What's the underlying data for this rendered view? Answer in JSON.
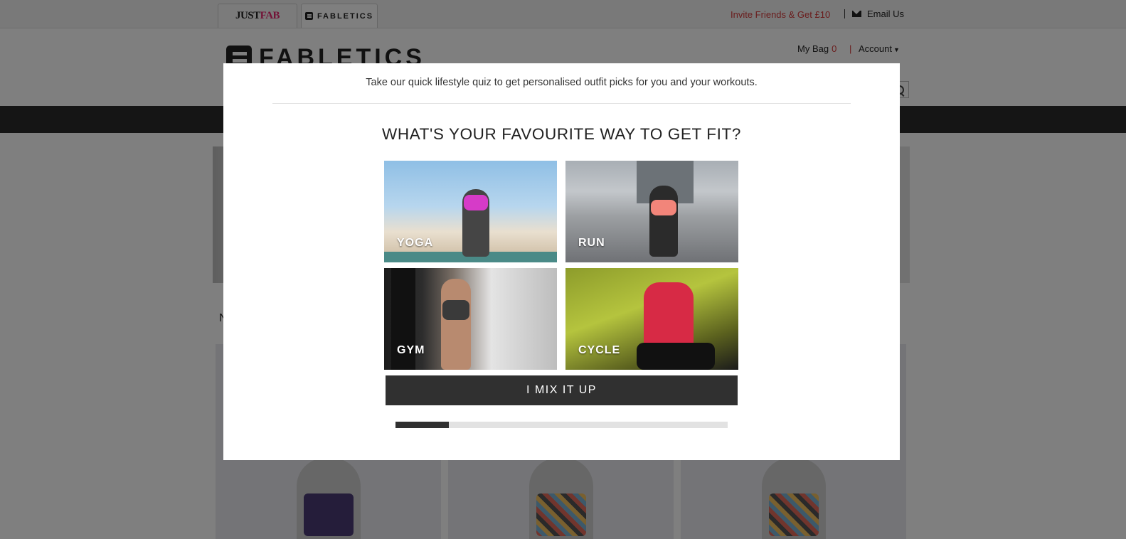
{
  "topbar": {
    "brand_tabs": [
      {
        "label_just": "JUST",
        "label_fab": "FAB"
      },
      {
        "label": "FABLETICS"
      }
    ],
    "invite_link": "Invite Friends & Get £10",
    "email_link": "Email Us"
  },
  "header": {
    "logo_text": "FABLETICS",
    "my_bag_label": "My Bag",
    "bag_count": "0",
    "separator": "|",
    "account_label": "Account"
  },
  "section": {
    "title_partial": "N",
    "more_arrow": "›"
  },
  "modal": {
    "intro": "Take our quick lifestyle quiz to get personalised outfit picks for you and your workouts.",
    "question": "WHAT'S YOUR FAVOURITE WAY TO GET FIT?",
    "options": [
      {
        "label": "YOGA"
      },
      {
        "label": "RUN"
      },
      {
        "label": "GYM"
      },
      {
        "label": "CYCLE"
      }
    ],
    "mix_button": "I MIX IT UP",
    "progress_fraction": 0.16
  },
  "icons": {
    "email": "envelope-icon",
    "search": "search-icon",
    "account_caret": "chevron-down-icon"
  },
  "colors": {
    "accent_red": "#d43a3a",
    "justfab_pink": "#e6246e",
    "button_dark": "#303030"
  }
}
